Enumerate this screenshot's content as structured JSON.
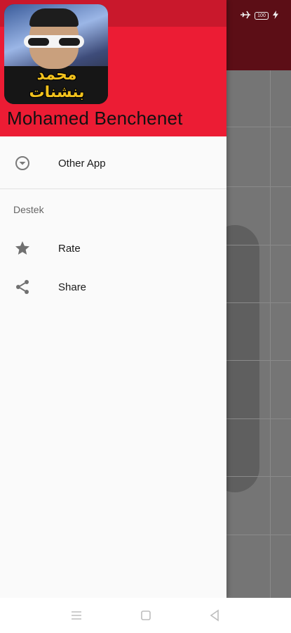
{
  "drawer": {
    "avatar_logo_text": "محمد بنشنات",
    "app_name": "Mohamed Benchenet",
    "items": [
      {
        "label": "Other App",
        "icon": "chevron-down-circle-icon"
      }
    ],
    "section_title": "Destek",
    "support_items": [
      {
        "label": "Rate",
        "icon": "star-icon"
      },
      {
        "label": "Share",
        "icon": "share-icon"
      }
    ]
  },
  "status_bar": {
    "battery": "100"
  },
  "colors": {
    "header": "#ec1c34",
    "header_top": "#c9182c",
    "accent_gold": "#f2c21d"
  }
}
